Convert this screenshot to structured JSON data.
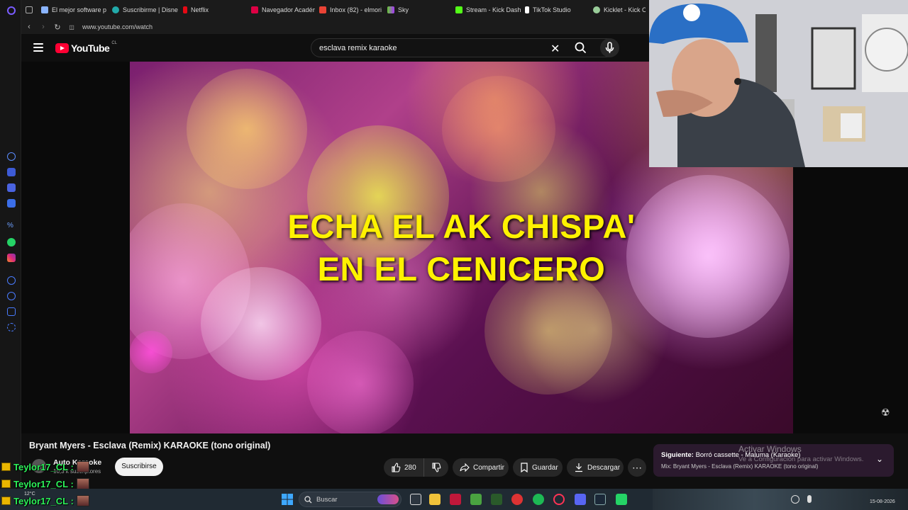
{
  "browser": {
    "tabs": [
      {
        "label": "El mejor software p",
        "color": "#4b9bff"
      },
      {
        "label": "Suscribirme | Disne",
        "color": "#2aa"
      },
      {
        "label": "Netflix",
        "color": "#e50914"
      },
      {
        "label": "Navegador Académ",
        "color": "#d04"
      },
      {
        "label": "Inbox (82) - elmori",
        "color": "#ea4335"
      },
      {
        "label": "Sky",
        "color": "#6c3"
      },
      {
        "label": "Stream - Kick Dash",
        "color": "#53fc18"
      },
      {
        "label": "TikTok Studio",
        "color": "#fff"
      },
      {
        "label": "Kicklet - Kick C",
        "color": "#9c9"
      }
    ],
    "url": "www.youtube.com/watch"
  },
  "youtube": {
    "logo_text": "YouTube",
    "country_code": "CL",
    "search_value": "esclava remix karaoke"
  },
  "video": {
    "lyric_line1": "ECHA EL AK CHISPA'",
    "lyric_line2": "EN EL CENICERO",
    "title": "Bryant Myers - Esclava (Remix) KARAOKE (tono original)"
  },
  "channel": {
    "name": "Auto Karaoke",
    "subscribers": "10,3 k suscriptores",
    "subscribe_label": "Suscribirse"
  },
  "actions": {
    "likes": "280",
    "share_label": "Compartir",
    "save_label": "Guardar",
    "download_label": "Descargar"
  },
  "up_next": {
    "label_prefix": "Siguiente:",
    "label_title": "Borró cassette - Maluma (Karaoke)",
    "mix": "Mix: Bryant Myers - Esclava (Remix) KARAOKE (tono original)"
  },
  "windows_watermark": {
    "line1": "Activar Windows",
    "line2": "Ve a Configuración para activar Windows."
  },
  "chat": [
    {
      "user": "Teylor17_CL :"
    },
    {
      "user": "Teylor17_CL :"
    },
    {
      "user": "Teylor17_CL :"
    }
  ],
  "taskbar": {
    "search_placeholder": "Buscar",
    "temperature": "12°C",
    "date": "15-08-2026"
  }
}
